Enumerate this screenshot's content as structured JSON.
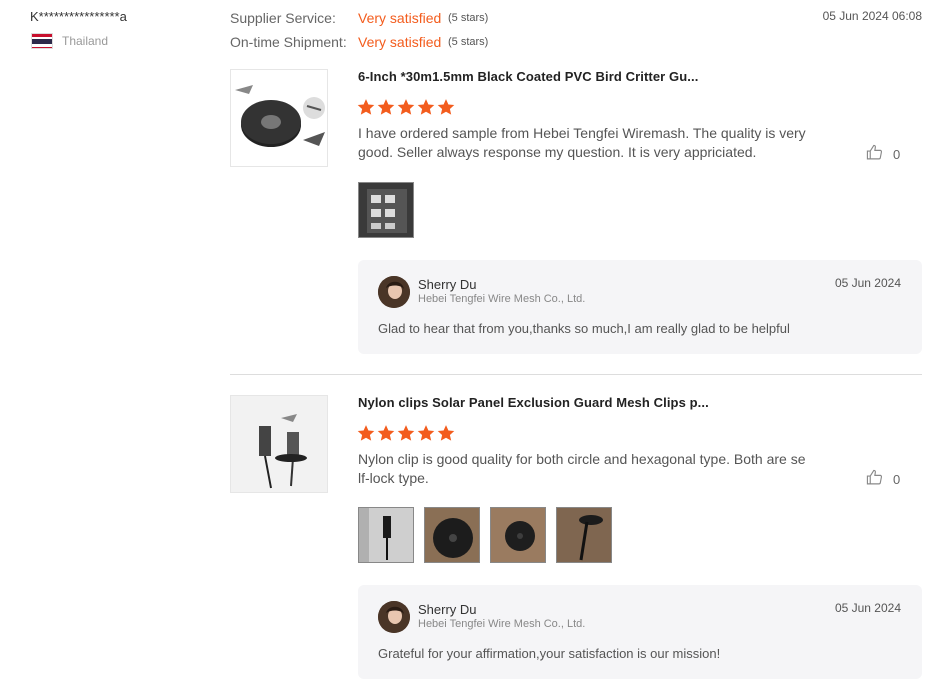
{
  "reviewer": {
    "name": "K****************a",
    "country": "Thailand"
  },
  "ratings": [
    {
      "label": "Supplier Service:",
      "value": "Very satisfied",
      "stars": "(5 stars)"
    },
    {
      "label": "On-time Shipment:",
      "value": "Very satisfied",
      "stars": "(5 stars)"
    }
  ],
  "review_date": "05 Jun 2024 06:08",
  "reviews": [
    {
      "product_title": "6-Inch *30m1.5mm Black Coated PVC Bird Critter Gu...",
      "rating": 5,
      "text": "I have ordered sample from Hebei Tengfei Wiremash. The quality is very good. Seller always response my question. It is very appriciated.",
      "likes": "0",
      "reply": {
        "name": "Sherry Du",
        "company": "Hebei Tengfei Wire Mesh Co., Ltd.",
        "date": "05 Jun 2024",
        "text": "Glad to hear that from you,thanks so much,I am really glad to be helpful"
      }
    },
    {
      "product_title": "Nylon clips Solar Panel Exclusion Guard Mesh Clips p...",
      "rating": 5,
      "text": "Nylon clip is good quality for both circle and hexagonal type. Both are self-lock type.",
      "likes": "0",
      "reply": {
        "name": "Sherry Du",
        "company": "Hebei Tengfei Wire Mesh Co., Ltd.",
        "date": "05 Jun 2024",
        "text": "Grateful for your affirmation,your satisfaction is our mission!"
      }
    }
  ],
  "colors": {
    "accent": "#f35c1d",
    "star": "#f35c1d"
  }
}
